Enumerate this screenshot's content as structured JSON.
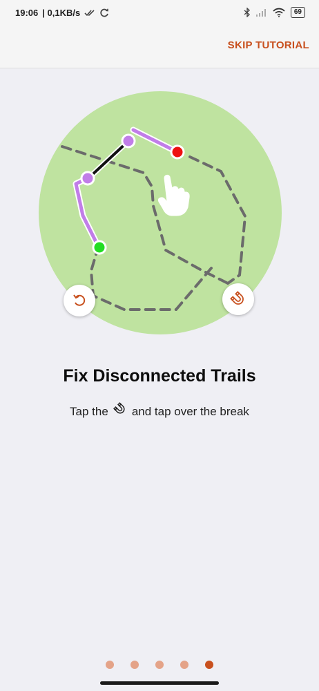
{
  "status_bar": {
    "time": "19:06",
    "network_speed": "| 0,1KB/s",
    "battery_level": "69"
  },
  "header": {
    "skip_label": "SKIP TUTORIAL"
  },
  "tutorial": {
    "title": "Fix Disconnected Trails",
    "subtitle_before": "Tap the",
    "subtitle_icon": "magnet-icon",
    "subtitle_after": "and tap over the break"
  },
  "pagination": {
    "total": 5,
    "current": 5
  },
  "colors": {
    "accent": "#c8501e",
    "circle": "#bfe3a0",
    "trail_dash": "#6b6b6b",
    "route_purple": "#c17de8",
    "start_point": "#22dd22",
    "end_point": "#ee1111",
    "dot_inactive": "#e4a388",
    "dot_active": "#c8501e"
  }
}
